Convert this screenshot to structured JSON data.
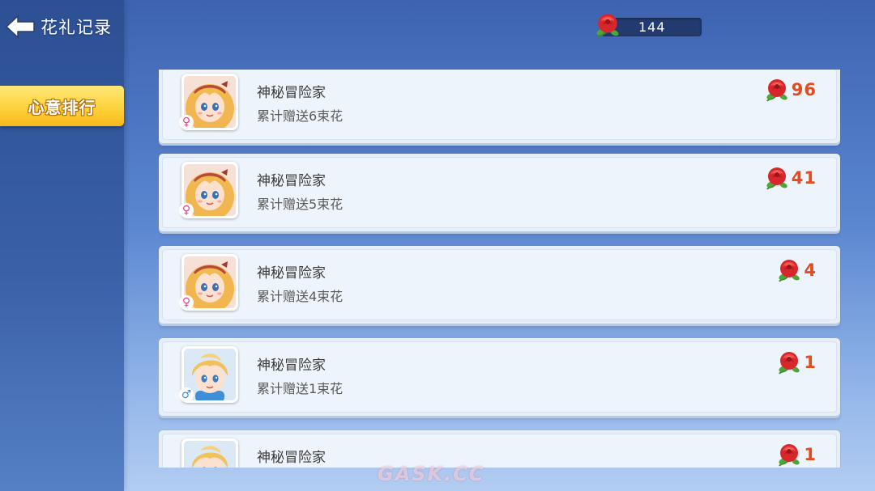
{
  "header": {
    "title": "花礼记录",
    "balance": "144"
  },
  "sidebar": {
    "tabs": [
      {
        "label": "心意排行",
        "active": true
      }
    ]
  },
  "records": [
    {
      "name": "神秘冒险家",
      "summary": "累计赠送6束花",
      "flowers": "96",
      "gender": "female",
      "gender_symbol": "♀"
    },
    {
      "name": "神秘冒险家",
      "summary": "累计赠送5束花",
      "flowers": "41",
      "gender": "female",
      "gender_symbol": "♀"
    },
    {
      "name": "神秘冒险家",
      "summary": "累计赠送4束花",
      "flowers": "4",
      "gender": "female",
      "gender_symbol": "♀"
    },
    {
      "name": "神秘冒险家",
      "summary": "累计赠送1束花",
      "flowers": "1",
      "gender": "male",
      "gender_symbol": "♂"
    },
    {
      "name": "神秘冒险家",
      "summary": "",
      "flowers": "1",
      "gender": "male",
      "gender_symbol": ""
    }
  ],
  "watermark": "GASK.CC",
  "colors": {
    "accent_yellow": "#ffd23c",
    "flower_count": "#e24c1e",
    "female": "#e83f84",
    "male": "#3f8fd8"
  }
}
